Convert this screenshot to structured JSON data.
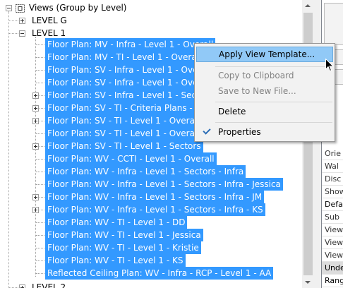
{
  "tree": {
    "root": {
      "label": "Views (Group by Level)"
    },
    "level_g": {
      "label": "LEVEL G"
    },
    "level_1": {
      "label": "LEVEL 1"
    },
    "items": [
      {
        "label": "Floor Plan: MV - Infra - Level 1 - Overall",
        "expander": false
      },
      {
        "label": "Floor Plan: MV - TI - Level 1 - Overall",
        "expander": false
      },
      {
        "label": "Floor Plan: SV - Infra - Level 1 - Overall",
        "expander": false
      },
      {
        "label": "Floor Plan: SV - Infra - Level 1 - Overall",
        "expander": false
      },
      {
        "label": "Floor Plan: SV - Infra - Level 1 - Sectors",
        "expander": true
      },
      {
        "label": "Floor Plan: SV - TI - Criteria Plans - Leve",
        "expander": true
      },
      {
        "label": "Floor Plan: SV - TI - Level 1 - Overall",
        "expander": true
      },
      {
        "label": "Floor Plan: SV - TI - Level 1 - Overall Pip",
        "expander": false
      },
      {
        "label": "Floor Plan: SV - TI - Level 1 - Sectors",
        "expander": true
      },
      {
        "label": "Floor Plan: WV - CCTI - Level 1 - Overall",
        "expander": false
      },
      {
        "label": "Floor Plan: WV - Infra - Level 1 - Sectors - Infra",
        "expander": false
      },
      {
        "label": "Floor Plan: WV - Infra - Level 1 - Sectors - Infra - Jessica",
        "expander": false
      },
      {
        "label": "Floor Plan: WV - Infra - Level 1 - Sectors - Infra - JM",
        "expander": true
      },
      {
        "label": "Floor Plan: WV - Infra - Level 1 - Sectors - Infra - KS",
        "expander": true
      },
      {
        "label": "Floor Plan: WV - TI - Level 1 - DD",
        "expander": false
      },
      {
        "label": "Floor Plan: WV - TI - Level 1 - Jessica",
        "expander": false
      },
      {
        "label": "Floor Plan: WV - TI - Level 1 - Kristie",
        "expander": false
      },
      {
        "label": "Floor Plan: WV - TI - Level 1 - KS",
        "expander": false
      },
      {
        "label": "Reflected Ceiling Plan: WV - Infra - RCP - Level 1 - AA",
        "expander": false
      }
    ],
    "level_2": {
      "label": "LEVEL 2"
    }
  },
  "context_menu": {
    "apply_view_template": "Apply View Template...",
    "copy_to_clipboard": "Copy to Clipboard",
    "save_to_new_file": "Save to New File...",
    "delete": "Delete",
    "properties": "Properties"
  },
  "properties_panel": {
    "rows": [
      {
        "label": "Orie",
        "style": "normal"
      },
      {
        "label": "Wal",
        "style": "normal"
      },
      {
        "label": "Disc",
        "style": "normal"
      },
      {
        "label": "Show",
        "style": "normal"
      },
      {
        "label": "Defa",
        "style": "dark"
      },
      {
        "label": "Sub",
        "style": "normal"
      },
      {
        "label": "View",
        "style": "normal"
      },
      {
        "label": "View",
        "style": "normal"
      },
      {
        "label": "View",
        "style": "normal"
      },
      {
        "label": "Unde",
        "style": "group"
      },
      {
        "label": "Rang",
        "style": "dark"
      }
    ]
  },
  "colors": {
    "selection": "#3399ff",
    "menu_highlight": "#91c9f7",
    "menu_background": "#f2f2f2"
  },
  "icons": [
    "view-group-icon",
    "expand-icon",
    "collapse-icon",
    "checkmark-icon",
    "scroll-up-icon",
    "scroll-down-icon",
    "mouse-cursor-icon"
  ]
}
